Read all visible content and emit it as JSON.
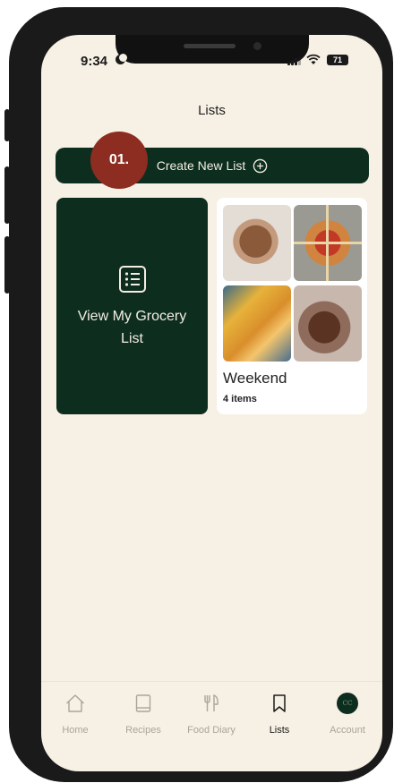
{
  "status_bar": {
    "time": "9:34",
    "battery": "71"
  },
  "header": {
    "title": "Lists"
  },
  "create_button": {
    "label": "Create New List"
  },
  "step_badge": {
    "label": "01."
  },
  "grocery_card": {
    "label": "View My Grocery List"
  },
  "lists": [
    {
      "name": "Weekend",
      "count": "4 items"
    }
  ],
  "tabs": [
    {
      "label": "Home",
      "icon": "home-icon"
    },
    {
      "label": "Recipes",
      "icon": "book-icon"
    },
    {
      "label": "Food Diary",
      "icon": "fork-knife-icon"
    },
    {
      "label": "Lists",
      "icon": "bookmark-icon",
      "active": true
    },
    {
      "label": "Account",
      "icon": "avatar"
    }
  ],
  "account": {
    "initials": "CC"
  },
  "colors": {
    "accent": "#0d2e1f",
    "background": "#f7f0e4",
    "badge": "#8d2c20"
  }
}
